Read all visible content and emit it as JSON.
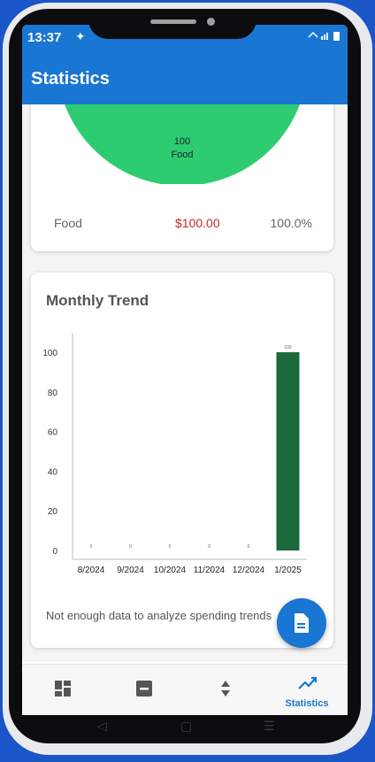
{
  "status_bar": {
    "time": "13:37"
  },
  "app_bar": {
    "title": "Statistics"
  },
  "category_chart": {
    "slice_label_value": "100",
    "slice_label_name": "Food",
    "legend": [
      {
        "name": "Food",
        "amount": "$100.00",
        "percent": "100.0%"
      }
    ]
  },
  "trend_card": {
    "title": "Monthly Trend",
    "note": "Not enough data to analyze spending trends"
  },
  "bottom_nav": {
    "items": [
      {
        "icon": "dashboard-icon",
        "label": ""
      },
      {
        "icon": "minus-box-icon",
        "label": ""
      },
      {
        "icon": "sort-icon",
        "label": ""
      },
      {
        "icon": "trending-up-icon",
        "label": "Statistics"
      }
    ]
  },
  "colors": {
    "primary": "#1976d2",
    "pie_green": "#2ecc71",
    "bar_green": "#1b6b3a",
    "expense_red": "#c62828"
  },
  "chart_data": [
    {
      "type": "pie",
      "categories": [
        "Food"
      ],
      "values": [
        100
      ]
    },
    {
      "type": "bar",
      "categories": [
        "8/2024",
        "9/2024",
        "10/2024",
        "11/2024",
        "12/2024",
        "1/2025"
      ],
      "values": [
        0,
        0,
        0,
        0,
        0,
        100
      ],
      "data_labels": [
        "0",
        "0",
        "0",
        "0",
        "0",
        "100"
      ],
      "y_ticks": [
        0,
        20,
        40,
        60,
        80,
        100
      ],
      "ylim": [
        0,
        100
      ],
      "grid": false
    }
  ]
}
